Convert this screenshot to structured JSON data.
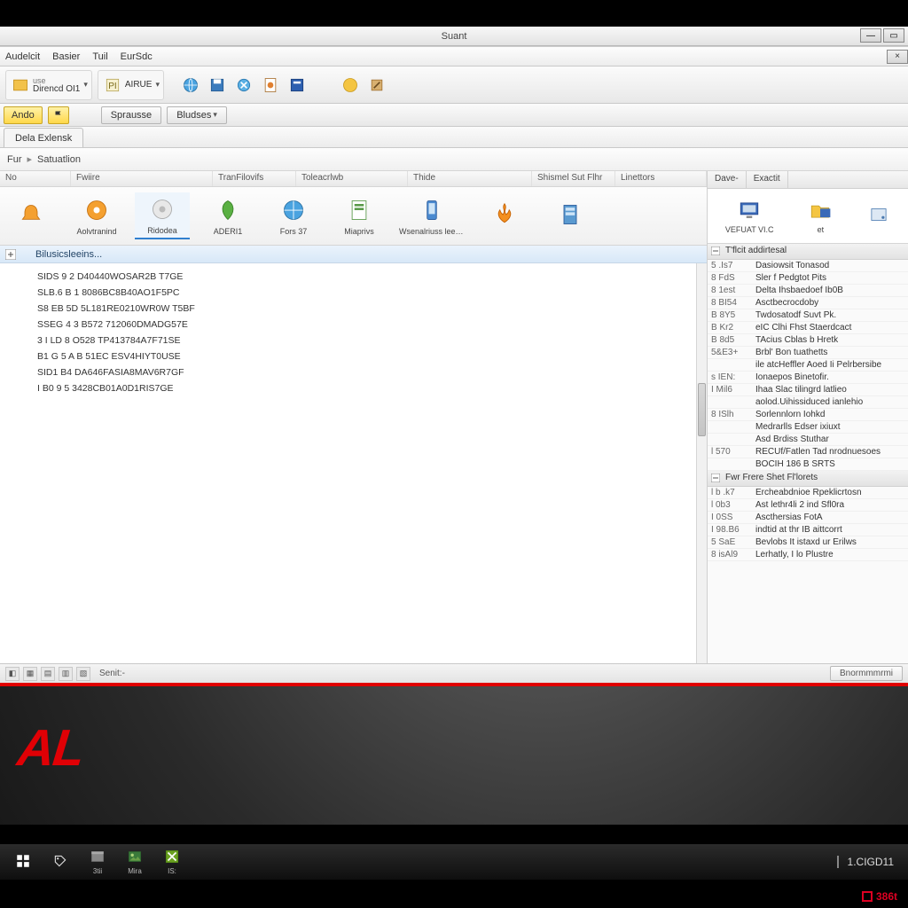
{
  "window": {
    "title": "Suant"
  },
  "menubar": [
    "Audelcit",
    "Basier",
    "Tuil",
    "EurSdc"
  ],
  "maintoolbar": {
    "group1_label": "Direncd OI1",
    "group2_label": "AIRUE"
  },
  "secondbar": {
    "yellow1": "Ando",
    "yellow2": "",
    "grey1": "Sprausse",
    "grey2": "Bludses"
  },
  "tabs": {
    "tab1": "Dela Exlensk"
  },
  "breadcrumb": {
    "seg1": "Fur",
    "seg2": "Satuatlion"
  },
  "columns": [
    "No",
    "Fwiire",
    "TranFilovifs",
    "Toleacrlwb",
    "Thide",
    "Shismel Sut Flhr",
    "Linettors"
  ],
  "ribbon": [
    {
      "label": "",
      "icon": "bell-orange"
    },
    {
      "label": "Aolvtranind",
      "icon": "disc-orange",
      "active": false
    },
    {
      "label": "Ridodea",
      "icon": "disc-grey",
      "active": true
    },
    {
      "label": "ADERI1",
      "icon": "leaf-green"
    },
    {
      "label": "Fors 37",
      "icon": "globe-blue"
    },
    {
      "label": "Miaprivs",
      "icon": "sheet-green"
    },
    {
      "label": "Wsenalriuss leeapta",
      "icon": "phone-blue"
    },
    {
      "label": "",
      "icon": "flame-orange"
    },
    {
      "label": "",
      "icon": "server-blue"
    }
  ],
  "subheader": "Bilusicsleeins...",
  "listrows": [
    "SIDS 9 2  D40440WOSAR2B T7GE",
    "SLB.6 B 1  8086BC8B40AO1F5PC",
    "S8 EB 5D  5L181RE0210WR0W T5BF",
    "SSEG 4 3  B572 712060DMADG57E",
    "3 I LD 8  O528 TP413784A7F71SE",
    "B1 G 5 A  B 51EC ESV4HIYT0USE",
    "SID1 B4  DA646FASIA8MAV6R7GF",
    "I B0 9 5  3428CB01A0D1RIS7GE"
  ],
  "rightpane": {
    "tabs": [
      "Dave-",
      "Exactit"
    ],
    "icons": [
      {
        "label": "VEFUAT VI.C",
        "icon": "monitor-blue"
      },
      {
        "label": "et",
        "icon": "folder-yellow"
      },
      {
        "label": "",
        "icon": "drive-blue"
      }
    ],
    "section1_head": "T'flcit addirtesal",
    "section1": [
      {
        "id": "5 .Is7",
        "desc": "Dasiowsit Tonasod"
      },
      {
        "id": "8 FdS",
        "desc": "Sler f Pedgtot Pits"
      },
      {
        "id": "8 1est",
        "desc": "Delta Ihsbaedoef Ib0B"
      },
      {
        "id": "8 BI54",
        "desc": "Asctbecrocdoby"
      },
      {
        "id": "B 8Y5",
        "desc": "Twdosatodf Suvt Pk."
      },
      {
        "id": "B Kr2",
        "desc": "eIC Clhi Fhst Staerdcact"
      },
      {
        "id": "B 8d5",
        "desc": "TAcius Cblas b Hretk"
      },
      {
        "id": "5&E3+",
        "desc": "Brbl' Bon tuathetts"
      },
      {
        "id": "",
        "desc": "ile atcHeffler Aoed Ii Pelrbersibe"
      },
      {
        "id": "s IEN:",
        "desc": "Ionaepos Binetofir."
      },
      {
        "id": "I Mil6",
        "desc": "Ihaa Slac tilingrd latlieo"
      },
      {
        "id": "",
        "desc": "aolod.Uihissiduced ianlehio"
      },
      {
        "id": "8 ISlh",
        "desc": "Sorlennlorn Iohkd"
      },
      {
        "id": "",
        "desc": "Medrarlls Edser ixiuxt"
      },
      {
        "id": "",
        "desc": "Asd Brdiss Stuthar"
      },
      {
        "id": "l 570",
        "desc": "RECUf/Fatlen Tad nrodnuesoes"
      },
      {
        "id": "",
        "desc": "BOCIH 186 B SRTS"
      }
    ],
    "section2_head": "Fwr            Frere Shet Fl'lorets",
    "section2": [
      {
        "id": "l b .k7",
        "desc": "Ercheabdnioe Rpeklicrtosn"
      },
      {
        "id": "l 0b3",
        "desc": "Ast lethr4li 2 ind Sfl0ra"
      },
      {
        "id": "I 0SS",
        "desc": "Ascthersias FotA"
      },
      {
        "id": "I 98.B6",
        "desc": "indtid at thr IB aittcorrt"
      },
      {
        "id": "5 SaE",
        "desc": "Bevlobs It istaxd ur Erilws"
      },
      {
        "id": "8 isAl9",
        "desc": "Lerhatly, I lo Plustre"
      }
    ]
  },
  "statusbar": {
    "text": "Senit:-",
    "right_button": "Bnormmmrmi"
  },
  "taskbar": {
    "items": [
      {
        "label": "",
        "icon": "start-win"
      },
      {
        "label": "",
        "icon": "tag-white"
      },
      {
        "label": "3tii",
        "icon": "panel-grey"
      },
      {
        "label": "Mira",
        "icon": "picture-green"
      },
      {
        "label": "IS:",
        "icon": "xbox-green"
      }
    ],
    "clock": "1.CIGD11"
  },
  "tray_tag": "386t",
  "brand": "AL"
}
